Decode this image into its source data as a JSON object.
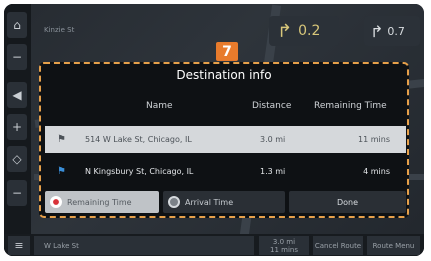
{
  "map": {
    "street_label": "Kinzie St",
    "bottom_address": "W Lake St"
  },
  "guidance": {
    "next_turn_distance": "0.2",
    "second_turn_distance": "0.7"
  },
  "dialog": {
    "badge_number": "7",
    "title": "Destination info",
    "columns": {
      "name": "Name",
      "distance": "Distance",
      "remaining_time": "Remaining Time"
    },
    "rows": [
      {
        "name": "514 W Lake St, Chicago, IL",
        "distance": "3.0 mi",
        "remaining_time": "11 mins",
        "icon": "waypoint-flag-icon"
      },
      {
        "name": "N Kingsbury St, Chicago, IL",
        "distance": "1.3 mi",
        "remaining_time": "4 mins",
        "icon": "destination-flag-icon"
      }
    ],
    "buttons": {
      "remaining_time": "Remaining Time",
      "arrival_time": "Arrival Time",
      "done": "Done"
    },
    "selected_option": "remaining_time"
  },
  "bottom_bar": {
    "remaining": "3.0 mi\n11 mins",
    "cancel_route": "Cancel Route",
    "route_menu": "Route Menu"
  },
  "colors": {
    "accent": "#e87b2c",
    "highlight_row": "#d5d8db",
    "radio_selected": "#d9333a"
  }
}
